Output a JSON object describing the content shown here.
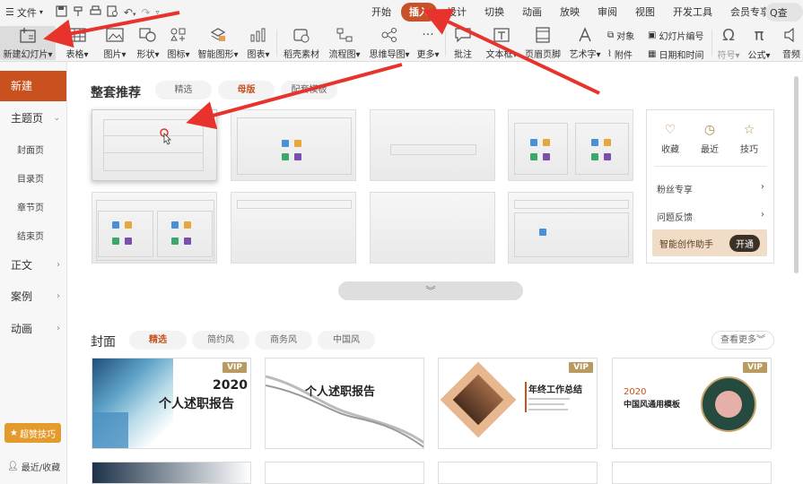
{
  "topbar": {
    "file_label": "文件",
    "tabs": [
      "开始",
      "插入",
      "设计",
      "切换",
      "动画",
      "放映",
      "审阅",
      "视图",
      "开发工具",
      "会员专享"
    ],
    "active_tab": "插入",
    "search_label": "Q查"
  },
  "ribbon": {
    "new_slide": "新建幻灯片",
    "table": "表格",
    "picture": "图片",
    "shape": "形状",
    "icon": "图标",
    "smartart": "智能图形",
    "chart": "图表",
    "docer": "稻壳素材",
    "flowchart": "流程图",
    "mindmap": "思维导图",
    "more": "更多",
    "comment": "批注",
    "textbox": "文本框",
    "header_footer": "页眉页脚",
    "wordart": "艺术字",
    "object": "对象",
    "slide_number": "幻灯片编号",
    "attachment": "附件",
    "datetime": "日期和时间",
    "symbol": "符号",
    "formula": "公式",
    "audio": "音频"
  },
  "sidebar": {
    "new": "新建",
    "theme": "主题页",
    "subs": [
      "封面页",
      "目录页",
      "章节页",
      "结束页"
    ],
    "body": "正文",
    "case": "案例",
    "animation": "动画",
    "skill": "超赞技巧",
    "recent": "最近/收藏"
  },
  "main": {
    "section1_title": "整套推荐",
    "section1_tabs": [
      "精选",
      "母版",
      "配套模板"
    ],
    "section1_active": "母版",
    "panel": {
      "fav": "收藏",
      "recent": "最近",
      "tips": "技巧",
      "fans": "粉丝专享",
      "feedback": "问题反馈",
      "ai": "智能创作助手",
      "open": "开通"
    },
    "section2_title": "封面",
    "section2_tabs": [
      "精选",
      "简约风",
      "商务风",
      "中国风"
    ],
    "section2_active": "精选",
    "see_more": "查看更多",
    "templates": [
      {
        "vip": "VIP",
        "year": "2020",
        "title": "个人述职报告"
      },
      {
        "vip": "",
        "title": "个人述职报告"
      },
      {
        "vip": "VIP",
        "title": "年终工作总结"
      },
      {
        "vip": "VIP",
        "year": "2020",
        "title": "中国风通用模板"
      }
    ]
  },
  "colors": {
    "accent": "#c8511f",
    "active_tab": "#c8512a",
    "arrow": "#e8322c",
    "vip": "#b89b61"
  }
}
